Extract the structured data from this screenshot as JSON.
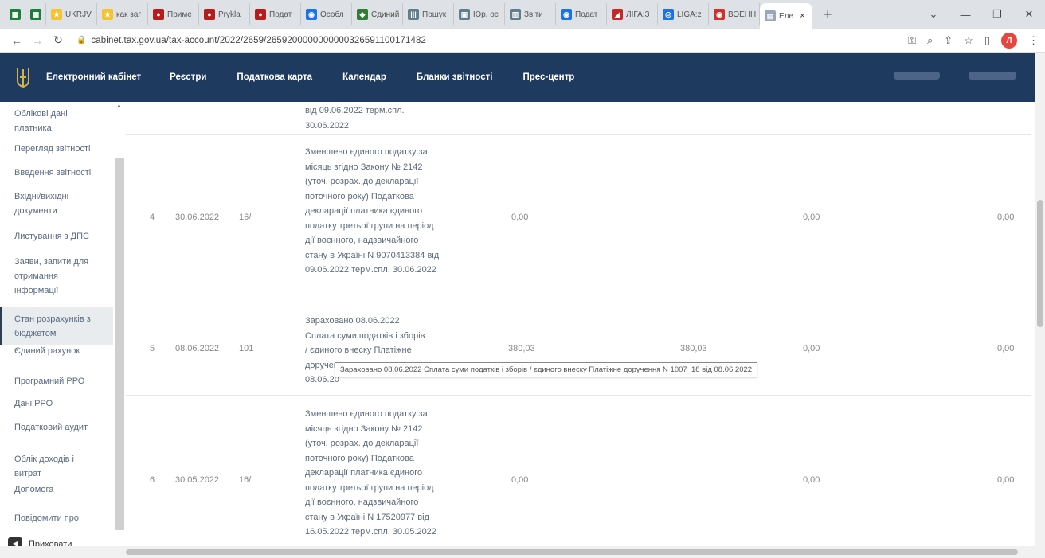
{
  "browser": {
    "tabs": [
      {
        "label": "",
        "color": "#188038",
        "glyph": "▦"
      },
      {
        "label": "",
        "color": "#188038",
        "glyph": "▦"
      },
      {
        "label": "UKRJV",
        "color": "#f4c430",
        "glyph": "★"
      },
      {
        "label": "как заг",
        "color": "#f4c430",
        "glyph": "★"
      },
      {
        "label": "Приме",
        "color": "#b71c1c",
        "glyph": "●"
      },
      {
        "label": "Prykla",
        "color": "#b71c1c",
        "glyph": "●"
      },
      {
        "label": "Подат",
        "color": "#b71c1c",
        "glyph": "●"
      },
      {
        "label": "Особл",
        "color": "#1a73e8",
        "glyph": "◉"
      },
      {
        "label": "Єдиний",
        "color": "#2e7d32",
        "glyph": "◆"
      },
      {
        "label": "Пошук",
        "color": "#607d8b",
        "glyph": "|||"
      },
      {
        "label": "Юр. ос",
        "color": "#607d8b",
        "glyph": "▣"
      },
      {
        "label": "Звіти",
        "color": "#607d8b",
        "glyph": "▥"
      },
      {
        "label": "Подат",
        "color": "#1a73e8",
        "glyph": "◉"
      },
      {
        "label": "ЛІГА:З",
        "color": "#c62828",
        "glyph": "◢"
      },
      {
        "label": "LIGA:z",
        "color": "#1a73e8",
        "glyph": "◎"
      },
      {
        "label": "ВОЕНН",
        "color": "#d32f2f",
        "glyph": "◉"
      }
    ],
    "active_tab": {
      "label": "Еле",
      "close": "×"
    },
    "new_tab": "+",
    "window_controls": [
      "⌄",
      "—",
      "❐",
      "✕"
    ],
    "url": "cabinet.tax.gov.ua/tax-account/2022/2659/2659200000000000326591100171482",
    "profile_initial": "Л"
  },
  "header": {
    "brand": "Електронний кабінет",
    "nav": [
      "Реєстри",
      "Податкова карта",
      "Календар",
      "Бланки звітності",
      "Прес-центр"
    ]
  },
  "sidebar": {
    "items": [
      "Облікові дані платника",
      "Перегляд звітності",
      "Введення звітності",
      "Вхідні/вихідні документи",
      "Листування з ДПС",
      "Заяви, запити для отримання інформації",
      "Стан розрахунків з бюджетом",
      "Єдиний рахунок",
      "Програмний РРО",
      "Дані РРО",
      "Податковий аудит",
      "Облік доходів і витрат",
      "Допомога",
      "Повідомити про помилку"
    ],
    "active_index": 6,
    "hide_label": "Приховати"
  },
  "table": {
    "partial_top": "від 09.06.2022 терм.спл.\n30.06.2022",
    "rows": [
      {
        "n": "4",
        "date": "30.06.2022",
        "code": "16/",
        "desc": "Зменшено єдиного податку за місяць згідно Закону № 2142 (уточ. розрах. до декларації поточного року) Податкова декларації платника єдиного податку третьої групи на період дії воєнного, надзвичайного стану в Україні N 9070413384 від 09.06.2022 терм.спл. 30.06.2022",
        "v1": "0,00",
        "v2": "",
        "v3": "0,00",
        "v4": "0,00"
      },
      {
        "n": "5",
        "date": "08.06.2022",
        "code": "101",
        "desc": "Зараховано 08.06.2022 Сплата суми податків і зборів / єдиного внеску Платіжне доручення N 1007_18 від 08.06.2022",
        "v1": "380,03",
        "v2": "380,03",
        "v3": "0,00",
        "v4": "0,00"
      },
      {
        "n": "6",
        "date": "30.05.2022",
        "code": "16/",
        "desc": "Зменшено єдиного податку за місяць згідно Закону № 2142 (уточ. розрах. до декларації поточного року) Податкова декларації платника єдиного податку третьої групи на період дії воєнного, надзвичайного стану в Україні N 17520977 від 16.05.2022 терм.спл. 30.05.2022",
        "v1": "0,00",
        "v2": "",
        "v3": "0,00",
        "v4": "0,00"
      }
    ],
    "row5_visible_desc": [
      "Зараховано 08.06.2022",
      "Сплата суми податків і зборів",
      "/ єдиного внеску Платіжне",
      "доручен",
      "08.06.20"
    ],
    "tooltip": "Зараховано 08.06.2022  Сплата суми податків і зборів / єдиного внеску Платіжне доручення N 1007_18 від 08.06.2022"
  }
}
